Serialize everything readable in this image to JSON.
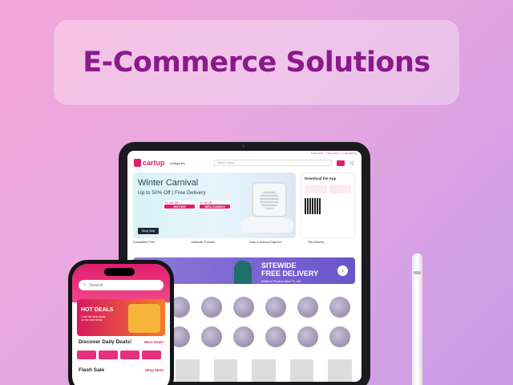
{
  "hero_title": "E-Commerce Solutions",
  "tablet": {
    "top_links": [
      "Track Order",
      "Help Center",
      "Login/Signup"
    ],
    "brand": "cartup",
    "categories_label": "Categories",
    "search_placeholder": "Search cartup",
    "banner": {
      "title": "Winter Carnival",
      "subtitle": "Up to 50% Off | Free Delivery",
      "coupons": [
        {
          "label": "Tk. 100 Off",
          "code": "HNY300"
        },
        {
          "label": "Tk. 60 Off",
          "code": "WELCOME60"
        }
      ],
      "button": "Shop Now"
    },
    "app_card_title": "Download the App",
    "features": [
      "Competitive Price",
      "Authentic Products",
      "Easy & Secured Payment",
      "Fast Delivery"
    ],
    "promo": {
      "line1": "SITEWIDE",
      "line2": "FREE DELIVERY",
      "note": "Minimum Product Value Tk. 100",
      "arrow": "›"
    }
  },
  "phone": {
    "search_placeholder": "Search",
    "hot_deals": {
      "title": "HOT DEALS",
      "sub": "Grab the best deals on the best items"
    },
    "section1": {
      "title": "Discover Daily Deals!",
      "more": "More Deals"
    },
    "section2": {
      "title": "Flash Sale",
      "more": "Shop More"
    }
  },
  "colors": {
    "brand": "#e01e6e",
    "title": "#8a1a8c",
    "promo": "#6a55c9"
  }
}
